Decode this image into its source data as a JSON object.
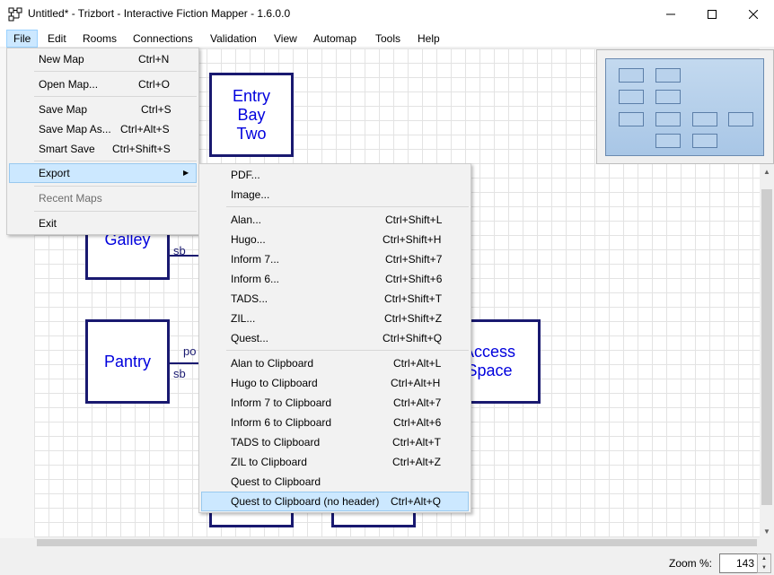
{
  "window": {
    "title": "Untitled* - Trizbort - Interactive Fiction Mapper - 1.6.0.0",
    "app_icon": "trizbort-map-icon"
  },
  "menubar": {
    "items": [
      "File",
      "Edit",
      "Rooms",
      "Connections",
      "Validation",
      "View",
      "Automap",
      "Tools",
      "Help"
    ]
  },
  "file_menu": {
    "new_map": {
      "label": "New Map",
      "shortcut": "Ctrl+N"
    },
    "open_map": {
      "label": "Open Map...",
      "shortcut": "Ctrl+O"
    },
    "save_map": {
      "label": "Save Map",
      "shortcut": "Ctrl+S"
    },
    "save_map_as": {
      "label": "Save Map As...",
      "shortcut": "Ctrl+Alt+S"
    },
    "smart_save": {
      "label": "Smart Save",
      "shortcut": "Ctrl+Shift+S"
    },
    "export": {
      "label": "Export"
    },
    "recent_maps": {
      "label": "Recent Maps"
    },
    "exit": {
      "label": "Exit"
    }
  },
  "export_menu": {
    "pdf": {
      "label": "PDF..."
    },
    "image": {
      "label": "Image..."
    },
    "alan": {
      "label": "Alan...",
      "shortcut": "Ctrl+Shift+L"
    },
    "hugo": {
      "label": "Hugo...",
      "shortcut": "Ctrl+Shift+H"
    },
    "inform7": {
      "label": "Inform 7...",
      "shortcut": "Ctrl+Shift+7"
    },
    "inform6": {
      "label": "Inform 6...",
      "shortcut": "Ctrl+Shift+6"
    },
    "tads": {
      "label": "TADS...",
      "shortcut": "Ctrl+Shift+T"
    },
    "zil": {
      "label": "ZIL...",
      "shortcut": "Ctrl+Shift+Z"
    },
    "quest": {
      "label": "Quest...",
      "shortcut": "Ctrl+Shift+Q"
    },
    "alan_clip": {
      "label": "Alan to Clipboard",
      "shortcut": "Ctrl+Alt+L"
    },
    "hugo_clip": {
      "label": "Hugo to Clipboard",
      "shortcut": "Ctrl+Alt+H"
    },
    "inform7_clip": {
      "label": "Inform 7 to Clipboard",
      "shortcut": "Ctrl+Alt+7"
    },
    "inform6_clip": {
      "label": "Inform 6 to Clipboard",
      "shortcut": "Ctrl+Alt+6"
    },
    "tads_clip": {
      "label": "TADS to Clipboard",
      "shortcut": "Ctrl+Alt+T"
    },
    "zil_clip": {
      "label": "ZIL to Clipboard",
      "shortcut": "Ctrl+Alt+Z"
    },
    "quest_clip": {
      "label": "Quest to Clipboard"
    },
    "quest_clip_noheader": {
      "label": "Quest to Clipboard (no header)",
      "shortcut": "Ctrl+Alt+Q"
    }
  },
  "map": {
    "rooms": {
      "entry_bay_two": "Entry\nBay\nTwo",
      "galley": "Galley",
      "pantry": "Pantry",
      "access_space": "Access\nSpace"
    },
    "labels": {
      "galley_sb": "sb",
      "pantry_po": "po",
      "pantry_sb": "sb"
    }
  },
  "statusbar": {
    "zoom_label": "Zoom %:",
    "zoom_value": "143"
  },
  "colors": {
    "room_border": "#191970",
    "room_text": "#0000dd",
    "menu_highlight": "#cce8ff"
  }
}
